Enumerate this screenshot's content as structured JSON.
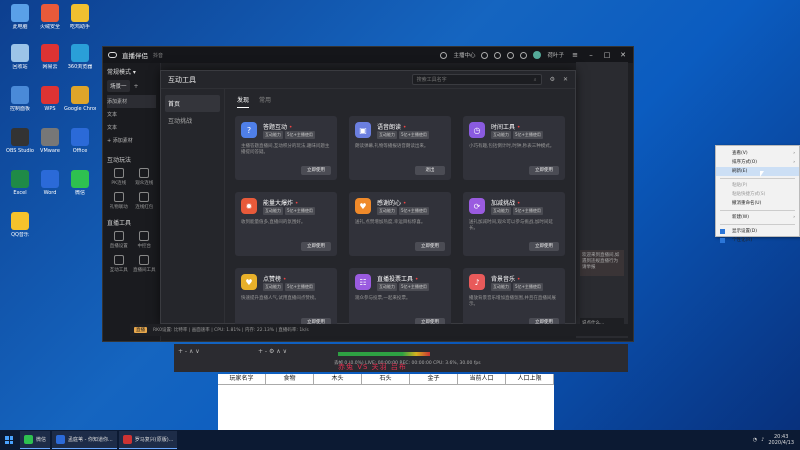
{
  "desktop": {
    "icons": [
      {
        "label": "此电脑",
        "color": "#5aa0e8"
      },
      {
        "label": "火绒安全",
        "color": "#e85a3a"
      },
      {
        "label": "吃鸡助手",
        "color": "#f0c030"
      },
      {
        "label": "回收站",
        "color": "#9cc4e8"
      },
      {
        "label": "网易云",
        "color": "#d33"
      },
      {
        "label": "360浏览器",
        "color": "#2a9fd8"
      },
      {
        "label": "控制面板",
        "color": "#4a8ad8"
      },
      {
        "label": "WPS",
        "color": "#d33"
      },
      {
        "label": "Google Chrome",
        "color": "#dfa52a"
      },
      {
        "label": "OBS Studio",
        "color": "#333"
      },
      {
        "label": "VMware",
        "color": "#777"
      },
      {
        "label": "Office",
        "color": "#2b6ad8"
      },
      {
        "label": "Excel",
        "color": "#1f8a47"
      },
      {
        "label": "Word",
        "color": "#2b6ad8"
      },
      {
        "label": "微信",
        "color": "#2ec150"
      },
      {
        "label": "QQ音乐",
        "color": "#f5c22c"
      }
    ]
  },
  "app": {
    "title": "直播伴侣",
    "subtitle": "抖音",
    "creator_center": "主播中心",
    "username": "荷叶子",
    "mode_select": "常规模式 ▾",
    "scene_tab": "场景一",
    "sources": [
      "添加素材",
      "文本",
      "文本",
      "+ 添加素材"
    ],
    "section_interact": "互动玩法",
    "interact_tools": [
      "PK连线",
      "观众连线",
      "礼物联动",
      "连线红包"
    ],
    "section_live_tools": "直播工具",
    "live_tools": [
      "直播设置",
      "中控台",
      "互动工具",
      "直播间工具"
    ],
    "status": {
      "live_chip": "直播",
      "text": "RK0设置: 比特率 | 画面速率 | CPU: 1.81% | 内存: 22.13% | 直播码率: 1k/s"
    }
  },
  "dialog": {
    "title": "互动工具",
    "search_placeholder": "搜索工具名字",
    "nav": [
      "首页",
      "互动挑战"
    ],
    "tabs": [
      "发现",
      "常用"
    ],
    "cards": [
      {
        "name": "答题互动",
        "badges": [
          "互动能力",
          "5亿+主播使用"
        ],
        "desc": "主播答题直播间,互动积分的玩法,趣味问题主播提问答疑。",
        "button": "立即使用",
        "icon_color": "#4f7fe8",
        "icon": "?"
      },
      {
        "name": "语音朗读",
        "badges": [
          "互动能力",
          "5亿+主播使用"
        ],
        "desc": "朗读弹幕,礼物等播报语音朗读出来。",
        "button": "退出",
        "icon_color": "#6b7fe0",
        "icon": "▣"
      },
      {
        "name": "时间工具",
        "badges": [
          "互动能力",
          "5亿+主播使用"
        ],
        "desc": "小巧有趣,包括倒计时,时钟,秒表三种模式。",
        "button": "立即使用",
        "icon_color": "#8a5be0",
        "icon": "◷"
      },
      {
        "name": "能量大爆炸",
        "badges": [
          "互动能力",
          "5亿+主播使用"
        ],
        "desc": "收到能量值多,直播间的氛围好。",
        "button": "立即使用",
        "icon_color": "#e85a3a",
        "icon": "✹"
      },
      {
        "name": "感谢的心",
        "badges": [
          "互动能力",
          "5亿+主播使用"
        ],
        "desc": "送礼,点赞增加热度,幸运目标惊喜。",
        "button": "立即使用",
        "icon_color": "#f08a2a",
        "icon": "♥"
      },
      {
        "name": "加减挑战",
        "badges": [
          "互动能力",
          "5亿+主播使用"
        ],
        "desc": "送礼加减时间,观众可以参与挑战,加时间延长。",
        "button": "立即使用",
        "icon_color": "#9a5be0",
        "icon": "⟳"
      },
      {
        "name": "点赞榜",
        "badges": [
          "互动能力",
          "5亿+主播使用"
        ],
        "desc": "快速提升直播人气,试用直播间点赞榜。",
        "button": "立即使用",
        "icon_color": "#e8b02a",
        "icon": "♥"
      },
      {
        "name": "直播投票工具",
        "badges": [
          "互动能力",
          "5亿+主播使用"
        ],
        "desc": "观众参与投票,一起来投票。",
        "button": "立即使用",
        "icon_color": "#9a5be0",
        "icon": "☷"
      },
      {
        "name": "背景音乐",
        "badges": [
          "互动能力",
          "5亿+主播使用"
        ],
        "desc": "播放背景音乐增加直播氛围,并且在直播间展示。",
        "button": "立即使用",
        "icon_color": "#e85a5a",
        "icon": "♪"
      }
    ]
  },
  "right_panel": {
    "notice": "欢迎来到直播间,如遇到违规直播行为请举报",
    "input_placeholder": "说点什么...",
    "send": "发送"
  },
  "context_menu": {
    "items": [
      {
        "label": "查看(V)",
        "sub": true,
        "disabled": false
      },
      {
        "label": "排序方式(O)",
        "sub": true,
        "disabled": false
      },
      {
        "label": "刷新(E)",
        "sub": false,
        "disabled": false,
        "hover": true
      },
      {
        "label": "粘贴(P)",
        "sub": false,
        "disabled": true
      },
      {
        "label": "粘贴快捷方式(S)",
        "sub": false,
        "disabled": true
      },
      {
        "label": "撤消重命名(U)",
        "sub": false,
        "disabled": false
      },
      {
        "label": "新建(W)",
        "sub": true,
        "disabled": false
      },
      {
        "label": "显示设置(D)",
        "sub": false,
        "disabled": false
      },
      {
        "label": "个性化(R)",
        "sub": false,
        "disabled": false
      }
    ]
  },
  "obs": {
    "row1": "+ - ∧ ∨",
    "row2": "+ - ⚙ ∧ ∨",
    "stats": "丢帧 0 (0.0%)  LIVE: 00:00:00  REC: 00:00:00  CPU: 3.6%, 30.00 fps"
  },
  "caption": "赤兔 VS 关羽 吕布",
  "table": {
    "headers": [
      "玩家名字",
      "食物",
      "木头",
      "石头",
      "金子",
      "当前人口",
      "人口上限"
    ]
  },
  "taskbar": {
    "apps": [
      {
        "label": "微信",
        "color": "#2ec150"
      },
      {
        "label": "孟庭苇 - 你知道你...",
        "color": "#2b6ad8"
      },
      {
        "label": "罗马复兴(原版)...",
        "color": "#c33"
      }
    ],
    "time": "20:43",
    "date": "2020/4/13"
  }
}
